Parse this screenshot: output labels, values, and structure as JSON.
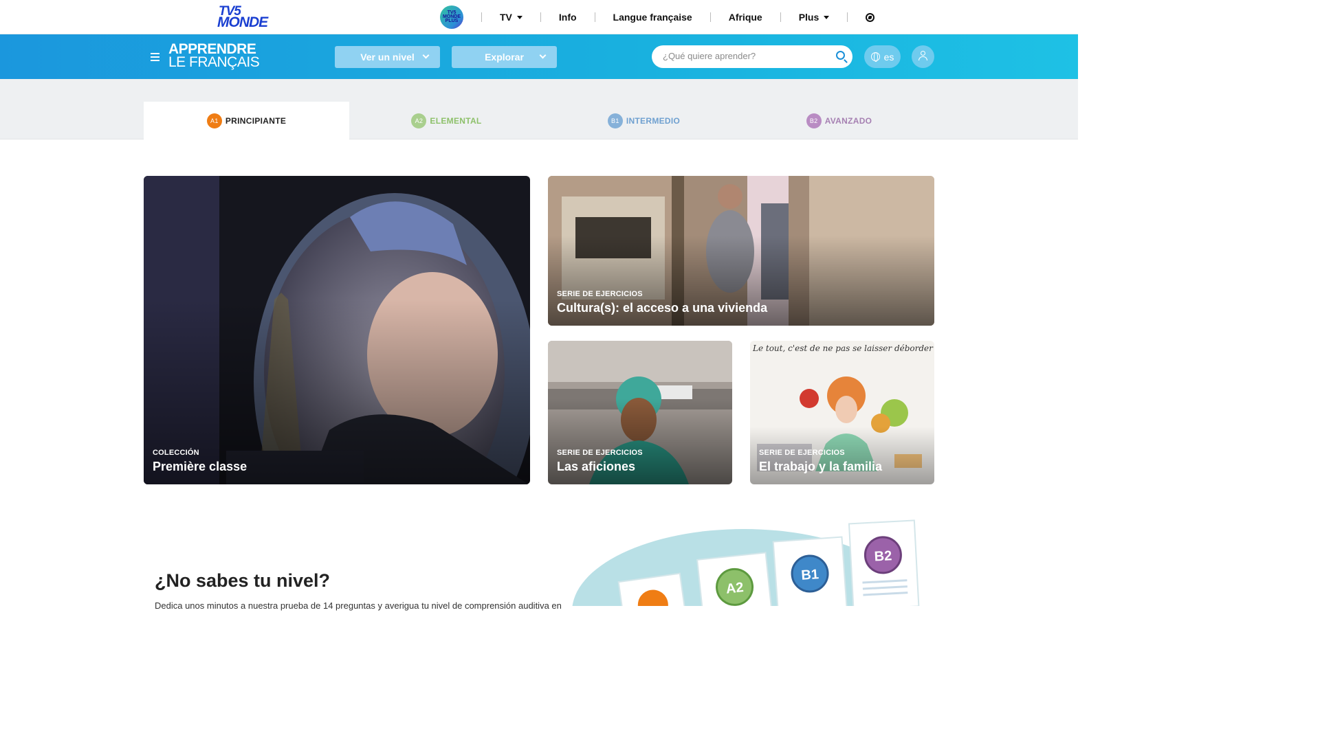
{
  "topbar": {
    "logo_line1": "TV5",
    "logo_line2": "MONDE",
    "plus_badge": "TV5 MONDE PLUS",
    "nav": [
      {
        "label": "TV",
        "has_caret": true
      },
      {
        "label": "Info",
        "has_caret": false
      },
      {
        "label": "Langue française",
        "has_caret": false
      },
      {
        "label": "Afrique",
        "has_caret": false
      },
      {
        "label": "Plus",
        "has_caret": true
      }
    ],
    "globe_icon": "globe-icon"
  },
  "header": {
    "brand_line1": "APPRENDRE",
    "brand_line2": "LE FRANÇAIS",
    "level_button": "Ver un nivel",
    "explore_button": "Explorar",
    "search_placeholder": "¿Qué quiere aprender?",
    "lang_label": "es",
    "accent": "#1b97dd"
  },
  "level_tabs": [
    {
      "code": "A1",
      "label": "PRINCIPIANTE",
      "color": "#ef7d14",
      "active": true
    },
    {
      "code": "A2",
      "label": "ELEMENTAL",
      "color": "#8dc06a",
      "active": false
    },
    {
      "code": "B1",
      "label": "INTERMEDIO",
      "color": "#4f90c9",
      "active": false
    },
    {
      "code": "B2",
      "label": "AVANZADO",
      "color": "#9b62a9",
      "active": false
    }
  ],
  "cards": [
    {
      "kind": "COLECCIÓN",
      "title": "Première classe"
    },
    {
      "kind": "SERIE DE EJERCICIOS",
      "title": "Cultura(s): el acceso a una vivienda"
    },
    {
      "kind": "SERIE DE EJERCICIOS",
      "title": "Las aficiones"
    },
    {
      "kind": "SERIE DE EJERCICIOS",
      "title": "El trabajo y la familia"
    }
  ],
  "card_image_caption": "Le tout, c'est de ne pas se laisser déborder",
  "no_level": {
    "title": "¿No sabes tu nivel?",
    "description": "Dedica unos minutos a nuestra prueba de 14 preguntas y averigua tu nivel de comprensión auditiva en"
  },
  "illustration_badges": [
    "A2",
    "B1",
    "B2"
  ]
}
